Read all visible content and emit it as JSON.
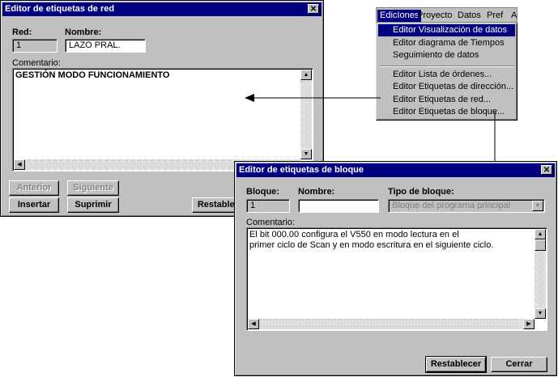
{
  "red_editor": {
    "title": "Editor de etiquetas de red",
    "red_label": "Red:",
    "red_value": "1",
    "nombre_label": "Nombre:",
    "nombre_value": "LAZO PRAL.",
    "comentario_label": "Comentario:",
    "comentario_value": "GESTIÓN MODO FUNCIONAMIENTO",
    "buttons": {
      "anterior": "Anterior",
      "siguiente": "Siguiente",
      "insertar": "Insertar",
      "suprimir": "Suprimir",
      "restablecer": "Restablecer"
    }
  },
  "menubar": {
    "items": [
      "EdicIones",
      "Proyecto",
      "Datos",
      "Pref",
      "A"
    ]
  },
  "menu": {
    "items": [
      "Editor Visualización de datos",
      "Editor diagrama de Tiempos",
      "Seguimiento de datos",
      "Editor Lista de órdenes...",
      "Editor Etiquetas de dirección...",
      "Editor Etiquetas de red...",
      "Editor Etiquetas de bloque..."
    ]
  },
  "bloque_editor": {
    "title": "Editor de etiquetas de bloque",
    "bloque_label": "Bloque:",
    "bloque_value": "1",
    "nombre_label": "Nombre:",
    "nombre_value": "",
    "tipo_label": "Tipo de bloque:",
    "tipo_value": "Bloque del programa principal",
    "comentario_label": "Comentario:",
    "comentario_line1": "El bit 000.00 configura el V550 en modo lectura en el",
    "comentario_line2": "primer ciclo de Scan y en modo escritura en el siguiente ciclo.",
    "buttons": {
      "restablecer": "Restablecer",
      "cerrar": "Cerrar"
    }
  },
  "colors": {
    "titlebar": "#000080",
    "window": "#c0c0c0"
  }
}
